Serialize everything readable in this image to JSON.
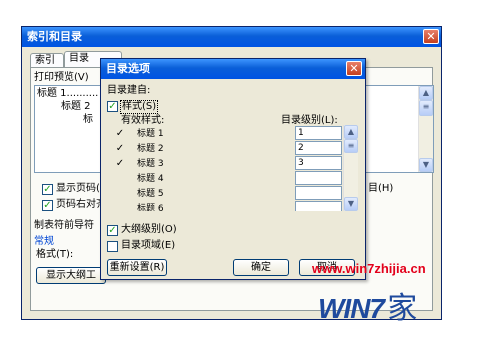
{
  "main_dialog": {
    "title": "索引和目录",
    "tabs": [
      "索引(X)",
      "目录"
    ],
    "preview_label": "打印预览(V)",
    "preview_lines": [
      "标题 1..........",
      "标题 2",
      "标"
    ],
    "show_page_numbers": "显示页码(",
    "right_align_page_numbers": "页码右对齐",
    "tab_leader": "制表符前导符",
    "general": "常规",
    "format_label": "格式(T):",
    "show_outline_button": "显示大纲工",
    "right_hint": "目(H)"
  },
  "options_dialog": {
    "title": "目录选项",
    "build_from": "目录建自:",
    "styles_checkbox": "样式(S)",
    "available_styles_header": "有效样式:",
    "toc_level_header": "目录级别(L):",
    "styles": [
      {
        "name": "标题 1",
        "checked": true,
        "level": "1"
      },
      {
        "name": "标题 2",
        "checked": true,
        "level": "2"
      },
      {
        "name": "标题 3",
        "checked": true,
        "level": "3"
      },
      {
        "name": "标题 4",
        "checked": false,
        "level": ""
      },
      {
        "name": "标题 5",
        "checked": false,
        "level": ""
      },
      {
        "name": "标题 6",
        "checked": false,
        "level": ""
      }
    ],
    "outline_levels": "大纲级别(O)",
    "toc_entry_fields": "目录项域(E)",
    "reset_button": "重新设置(R)",
    "ok_button": "确定",
    "cancel_button": "取消"
  },
  "watermark": {
    "url": "www.win7zhijia.cn",
    "logo_text": "WIN7",
    "logo_suffix": "家"
  }
}
